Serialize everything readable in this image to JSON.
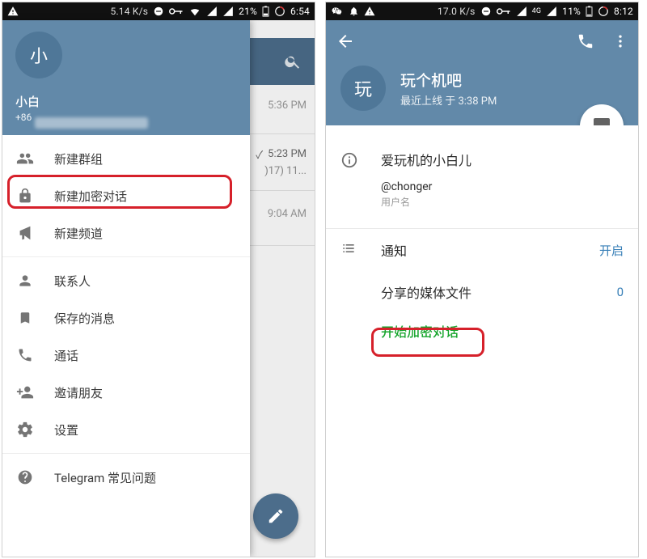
{
  "phone1": {
    "statusbar": {
      "speed": "5.14 K/s",
      "battery_pct": "21%",
      "clock": "6:54"
    },
    "appbar": {},
    "chats": {
      "row1_time": "5:36 PM",
      "row2_time": "5:23 PM",
      "row2_blurb": ")17) 11...",
      "row3_time": "9:04 AM"
    },
    "drawer": {
      "avatar_initial": "小",
      "name": "小白",
      "phone": "+86",
      "items": {
        "new_group": "新建群组",
        "new_secret_chat": "新建加密对话",
        "new_channel": "新建频道",
        "contacts": "联系人",
        "saved_messages": "保存的消息",
        "calls": "通话",
        "invite": "邀请朋友",
        "settings": "设置",
        "faq": "Telegram 常见问题"
      }
    }
  },
  "phone2": {
    "statusbar": {
      "speed": "17.0 K/s",
      "net_label": "4G",
      "battery_pct": "11%",
      "clock": "8:12"
    },
    "profile": {
      "avatar_initial": "玩",
      "name": "玩个机吧",
      "status": "最近上线 于 3:38 PM"
    },
    "info": {
      "display_name": "爱玩机的小白儿",
      "username": "@chonger",
      "username_caption": "用户名"
    },
    "rows": {
      "notifications_label": "通知",
      "notifications_value": "开启",
      "shared_media_label": "分享的媒体文件",
      "shared_media_value": "0",
      "start_secret_chat": "开始加密对话"
    }
  }
}
